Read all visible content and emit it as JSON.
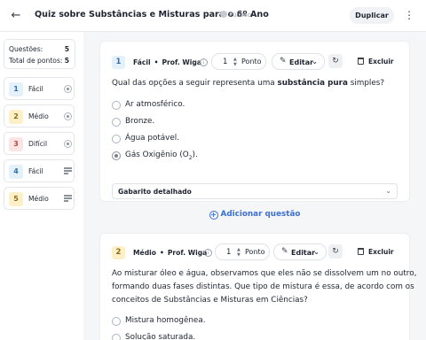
{
  "header": {
    "title": "Quiz sobre Substâncias e Misturas para o 6º Ano",
    "visibility": "Público",
    "duplicate_label": "Duplicar"
  },
  "sidebar": {
    "summary": {
      "questions_label": "Questões:",
      "questions_count": "5",
      "points_label": "Total de pontos:",
      "points_count": "5"
    },
    "items": [
      {
        "number": "1",
        "label": "Fácil",
        "type": "multiple-choice"
      },
      {
        "number": "2",
        "label": "Médio",
        "type": "multiple-choice"
      },
      {
        "number": "3",
        "label": "Difícil",
        "type": "multiple-choice"
      },
      {
        "number": "4",
        "label": "Fácil",
        "type": "text"
      },
      {
        "number": "5",
        "label": "Médio",
        "type": "text"
      }
    ]
  },
  "questions": [
    {
      "number": "1",
      "difficulty": "Fácil",
      "author": "Prof. Wiga",
      "points_value": "1",
      "points_unit": "Ponto",
      "edit_label": "Editar",
      "delete_label": "Excluir",
      "text_before": "Qual das opções a seguir representa uma ",
      "text_bold": "substância pura",
      "text_after": " simples?",
      "options": [
        {
          "label": "Ar atmosférico.",
          "selected": false
        },
        {
          "label": "Bronze.",
          "selected": false
        },
        {
          "label": "Água potável.",
          "selected": false
        },
        {
          "label_before": "Gás Oxigênio (O",
          "label_sub": "2",
          "label_after": ").",
          "selected": true
        }
      ],
      "feedback_label": "Gabarito detalhado"
    },
    {
      "number": "2",
      "difficulty": "Médio",
      "author": "Prof. Wiga",
      "points_value": "1",
      "points_unit": "Ponto",
      "edit_label": "Editar",
      "delete_label": "Excluir",
      "text_lines": [
        "Ao misturar óleo e água, observamos que eles não se dissolvem um no outro,",
        "formando duas fases distintas. Que tipo de mistura é essa, de acordo com os",
        "conceitos de Substâncias e Misturas em Ciências?"
      ],
      "options": [
        {
          "label": "Mistura homogênea.",
          "selected": false
        },
        {
          "label": "Solução saturada.",
          "selected": false
        }
      ]
    }
  ],
  "add_question_label": "Adicionar questão",
  "colors": {
    "easy_bg": "#e4f1fb",
    "easy_fg": "#2f6fae",
    "medium_bg": "#fdf0c9",
    "medium_fg": "#8a6a12",
    "hard_bg": "#fbe4e4",
    "hard_fg": "#b2433f",
    "accent": "#3b6fd4"
  }
}
